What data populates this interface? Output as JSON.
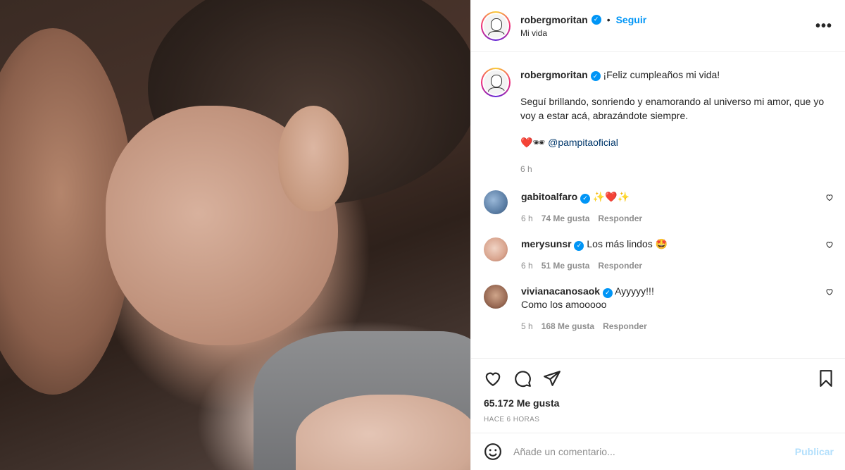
{
  "post": {
    "username": "robergmoritan",
    "follow_label": "Seguir",
    "location": "Mi vida",
    "more_label": "•••"
  },
  "caption": {
    "username": "robergmoritan",
    "title": "¡Feliz cumpleaños mi vida!",
    "body": "Seguí brillando, sonriendo y enamorando al universo mi amor, que yo voy a estar acá, abrazándote siempre.",
    "emoji": "❤️🕶",
    "mention": "@pampitaoficial",
    "time": "6 h"
  },
  "comments": [
    {
      "username": "gabitoalfaro",
      "text": "✨❤️✨",
      "time": "6 h",
      "likes": "74 Me gusta",
      "reply": "Responder"
    },
    {
      "username": "merysunsr",
      "text": "Los más lindos 🤩",
      "time": "6 h",
      "likes": "51 Me gusta",
      "reply": "Responder"
    },
    {
      "username": "vivianacanosaok",
      "text": "Ayyyyy!!!",
      "text2": "Como los amooooo",
      "time": "5 h",
      "likes": "168 Me gusta",
      "reply": "Responder"
    }
  ],
  "stats": {
    "likes": "65.172 Me gusta",
    "ago": "HACE 6 HORAS"
  },
  "composer": {
    "placeholder": "Añade un comentario...",
    "publish": "Publicar"
  },
  "colors": {
    "accent": "#0095f6",
    "publish_disabled": "#b2dffc",
    "muted": "#8e8e8e"
  },
  "icons": [
    "heart-icon",
    "comment-icon",
    "share-icon",
    "bookmark-icon",
    "emoji-icon",
    "verified-icon",
    "more-icon"
  ]
}
